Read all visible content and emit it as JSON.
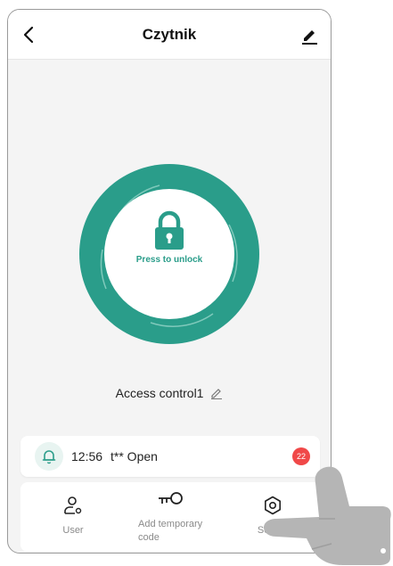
{
  "header": {
    "title": "Czytnik"
  },
  "unlock": {
    "label": "Press to unlock"
  },
  "device": {
    "name": "Access control1"
  },
  "log": {
    "time": "12:56",
    "text": "t** Open",
    "badge": "22"
  },
  "nav": {
    "user": "User",
    "temp_line1": "Add temporary",
    "temp_line2": "code",
    "setting": "Setting"
  },
  "colors": {
    "accent": "#2a9d8a",
    "badge": "#f04848",
    "background": "#f4f4f4"
  },
  "icons": [
    "back-arrow-icon",
    "edit-pencil-icon",
    "lock-icon",
    "bell-icon",
    "user-icon",
    "key-icon",
    "gear-icon",
    "pointing-hand-icon"
  ]
}
